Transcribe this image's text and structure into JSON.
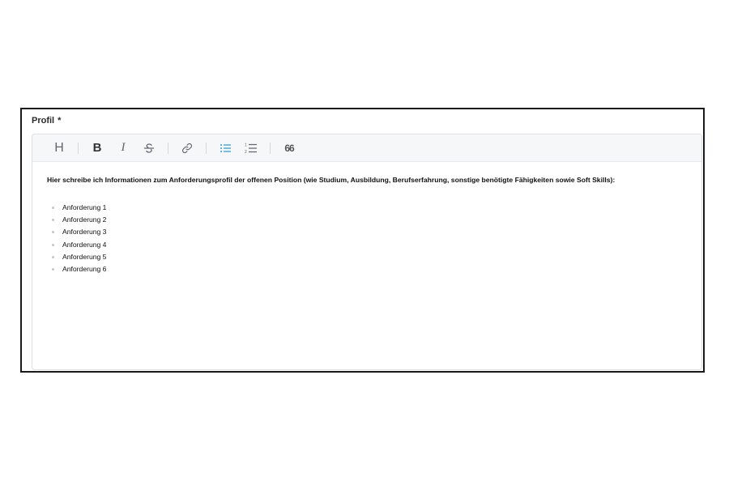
{
  "field": {
    "label": "Profil",
    "required_marker": "*"
  },
  "toolbar": {
    "heading_glyph": "H",
    "bold_glyph": "B",
    "italic_glyph": "I",
    "quote_glyph": "66",
    "active_color": "#2b9bd8",
    "icons": [
      "heading-icon",
      "bold-icon",
      "italic-icon",
      "strikethrough-icon",
      "link-icon",
      "bullet-list-icon",
      "numbered-list-icon",
      "quote-icon"
    ]
  },
  "editor": {
    "intro": "Hier schreibe ich Informationen zum Anforderungsprofil der offenen Position (wie Studium, Ausbildung, Berufserfahrung, sonstige benötigte Fähigkeiten sowie Soft Skills):",
    "items": [
      "Anforderung 1",
      "Anforderung 2",
      "Anforderung 3",
      "Anforderung 4",
      "Anforderung 5",
      "Anforderung 6"
    ]
  }
}
